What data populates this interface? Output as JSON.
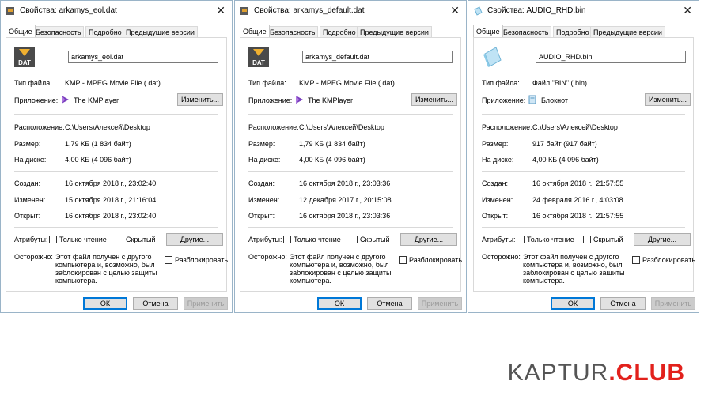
{
  "labels": {
    "type": "Тип файла:",
    "app": "Приложение:",
    "location": "Расположение:",
    "size": "Размер:",
    "disk": "На диске:",
    "created": "Создан:",
    "modified": "Изменен:",
    "opened": "Открыт:",
    "attributes": "Атрибуты:",
    "caution": "Осторожно:",
    "readonly": "Только чтение",
    "hidden": "Скрытый",
    "other_btn": "Другие...",
    "unblock": "Разблокировать",
    "change_btn": "Изменить...",
    "ok": "ОК",
    "cancel": "Отмена",
    "apply": "Применить"
  },
  "tabs": [
    "Общие",
    "Безопасность",
    "Подробно",
    "Предыдущие версии"
  ],
  "windows": [
    {
      "title": "Свойства: arkamys_eol.dat",
      "filename": "arkamys_eol.dat",
      "icon": "dat-file-icon",
      "type": "KMP - MPEG Movie File (.dat)",
      "app": "The KMPlayer",
      "app_icon": "kmplayer-icon",
      "location": "C:\\Users\\Алексей\\Desktop",
      "size": "1,79 КБ (1 834 байт)",
      "disk": "4,00 КБ (4 096 байт)",
      "created": "16 октября 2018 г., 23:02:40",
      "modified": "15 октября 2018 г., 21:16:04",
      "opened": "16 октября 2018 г., 23:02:40",
      "caution_text": [
        "Этот файл получен с другого",
        "компьютера и, возможно, был",
        "заблокирован с целью защиты",
        "компьютера."
      ]
    },
    {
      "title": "Свойства: arkamys_default.dat",
      "filename": "arkamys_default.dat",
      "icon": "dat-file-icon",
      "type": "KMP - MPEG Movie File (.dat)",
      "app": "The KMPlayer",
      "app_icon": "kmplayer-icon",
      "location": "C:\\Users\\Алексей\\Desktop",
      "size": "1,79 КБ (1 834 байт)",
      "disk": "4,00 КБ (4 096 байт)",
      "created": "16 октября 2018 г., 23:03:36",
      "modified": "12 декабря 2017 г., 20:15:08",
      "opened": "16 октября 2018 г., 23:03:36",
      "caution_text": [
        "Этот файл получен с другого",
        "компьютера и, возможно, был",
        "заблокирован с целью защиты",
        "компьютера."
      ]
    },
    {
      "title": "Свойства: AUDIO_RHD.bin",
      "filename": "AUDIO_RHD.bin",
      "icon": "bin-file-icon",
      "type": "Файл \"BIN\" (.bin)",
      "app": "Блокнот",
      "app_icon": "notepad-icon",
      "location": "C:\\Users\\Алексей\\Desktop",
      "size": "917 байт (917 байт)",
      "disk": "4,00 КБ (4 096 байт)",
      "created": "16 октября 2018 г., 21:57:55",
      "modified": "24 февраля 2016 г., 4:03:08",
      "opened": "16 октября 2018 г., 21:57:55",
      "caution_text": [
        "Этот файл получен с другого",
        "компьютера и, возможно, был",
        "заблокирован с целью защиты",
        "компьютера."
      ]
    }
  ],
  "watermark": "KAPTUR.CLUB"
}
